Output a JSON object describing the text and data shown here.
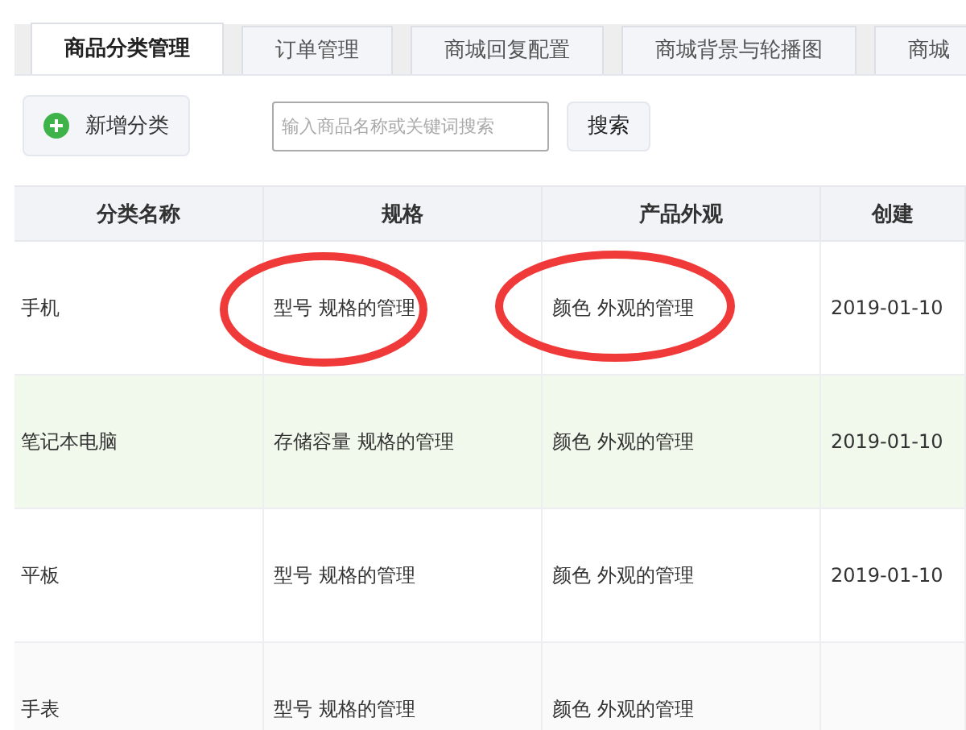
{
  "tabs": [
    {
      "label": "商品分类管理",
      "selected": true
    },
    {
      "label": "订单管理",
      "selected": false
    },
    {
      "label": "商城回复配置",
      "selected": false
    },
    {
      "label": "商城背景与轮播图",
      "selected": false
    },
    {
      "label": "商城",
      "selected": false
    }
  ],
  "toolbar": {
    "add_button": "新增分类",
    "search": {
      "placeholder": "输入商品名称或关键词搜索"
    },
    "search_button": "搜索"
  },
  "table": {
    "columns": [
      "分类名称",
      "规格",
      "产品外观",
      "创建"
    ],
    "rows": [
      {
        "name": "手机",
        "spec": "型号  规格的管理",
        "spec_circled": true,
        "appearance": "颜色  外观的管理",
        "appearance_circled": true,
        "created": "2019-01-10",
        "hovered": false
      },
      {
        "name": "笔记本电脑",
        "spec": "存储容量  规格的管理",
        "spec_circled": false,
        "appearance": "颜色  外观的管理",
        "appearance_circled": false,
        "created": "2019-01-10",
        "hovered": true
      },
      {
        "name": "平板",
        "spec": "型号  规格的管理",
        "spec_circled": false,
        "appearance": "颜色  外观的管理",
        "appearance_circled": false,
        "created": "2019-01-10",
        "hovered": false
      },
      {
        "name": "手表",
        "spec": "型号  规格的管理",
        "spec_circled": false,
        "appearance": "颜色  外观的管理",
        "appearance_circled": false,
        "hovered": false
      }
    ]
  }
}
